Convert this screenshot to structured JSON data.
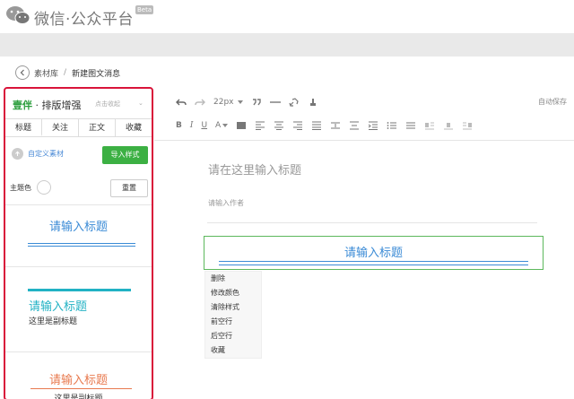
{
  "header": {
    "logo_text": "微信·公众平台",
    "beta": "Beta"
  },
  "breadcrumb": {
    "parent": "素材库",
    "separator": "/",
    "current": "新建图文消息"
  },
  "plugin": {
    "brand": "壹伴",
    "name": "· 排版增强",
    "collapse": "点击收起",
    "collapse_caret": "⌄",
    "tabs": [
      "标题",
      "关注",
      "正文",
      "收藏"
    ],
    "custom_material": "自定义素材",
    "import_style": "导入样式",
    "theme_color": "主题色",
    "reset": "重置",
    "samples": {
      "s1_title": "请输入标题",
      "s2_title": "请输入标题",
      "s2_sub": "这里是副标题",
      "s3_title": "请输入标题",
      "s3_sub": "这里是副标题"
    },
    "colors": {
      "border": "#d9143a",
      "brand": "#2a9d3b",
      "import_button": "#3cb043",
      "blue": "#3b8bd6",
      "teal": "#22b2c4",
      "orange": "#e87a4f"
    }
  },
  "toolbar": {
    "font_size": "22px",
    "autosave": "自动保存",
    "row2": [
      "B",
      "I",
      "U",
      "A"
    ]
  },
  "editor": {
    "title_placeholder": "请在这里输入标题",
    "author_placeholder": "请输入作者",
    "block_title": "请输入标题",
    "context_menu": [
      "删除",
      "修改颜色",
      "清除样式",
      "前空行",
      "后空行",
      "收藏"
    ]
  }
}
